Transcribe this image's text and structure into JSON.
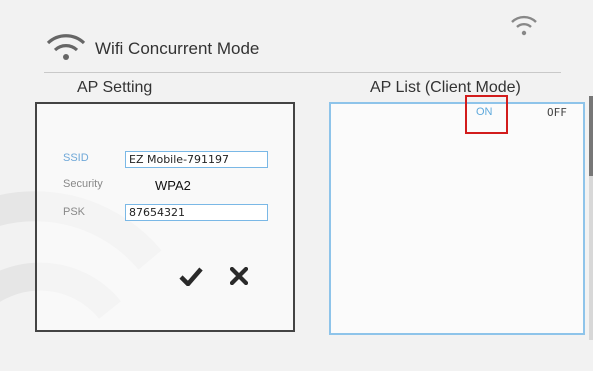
{
  "header": {
    "title": "Wifi Concurrent Mode",
    "wifi_icon": "wifi-icon"
  },
  "status_bar": {
    "wifi_icon": "wifi-icon"
  },
  "ap_setting": {
    "title": "AP Setting",
    "ssid_label": "SSID",
    "ssid_value": "EZ Mobile-791197",
    "security_label": "Security",
    "security_value": "WPA2",
    "psk_label": "PSK",
    "psk_value": "87654321",
    "confirm_icon": "checkmark-icon",
    "cancel_icon": "close-icon"
  },
  "ap_list": {
    "title": "AP List (Client Mode)",
    "on_label": "ON",
    "off_label": "OFF",
    "toggle_state": "ON"
  },
  "colors": {
    "accent": "#5fa9dc",
    "highlight": "#d21c1c",
    "background": "#f2f2f2"
  }
}
